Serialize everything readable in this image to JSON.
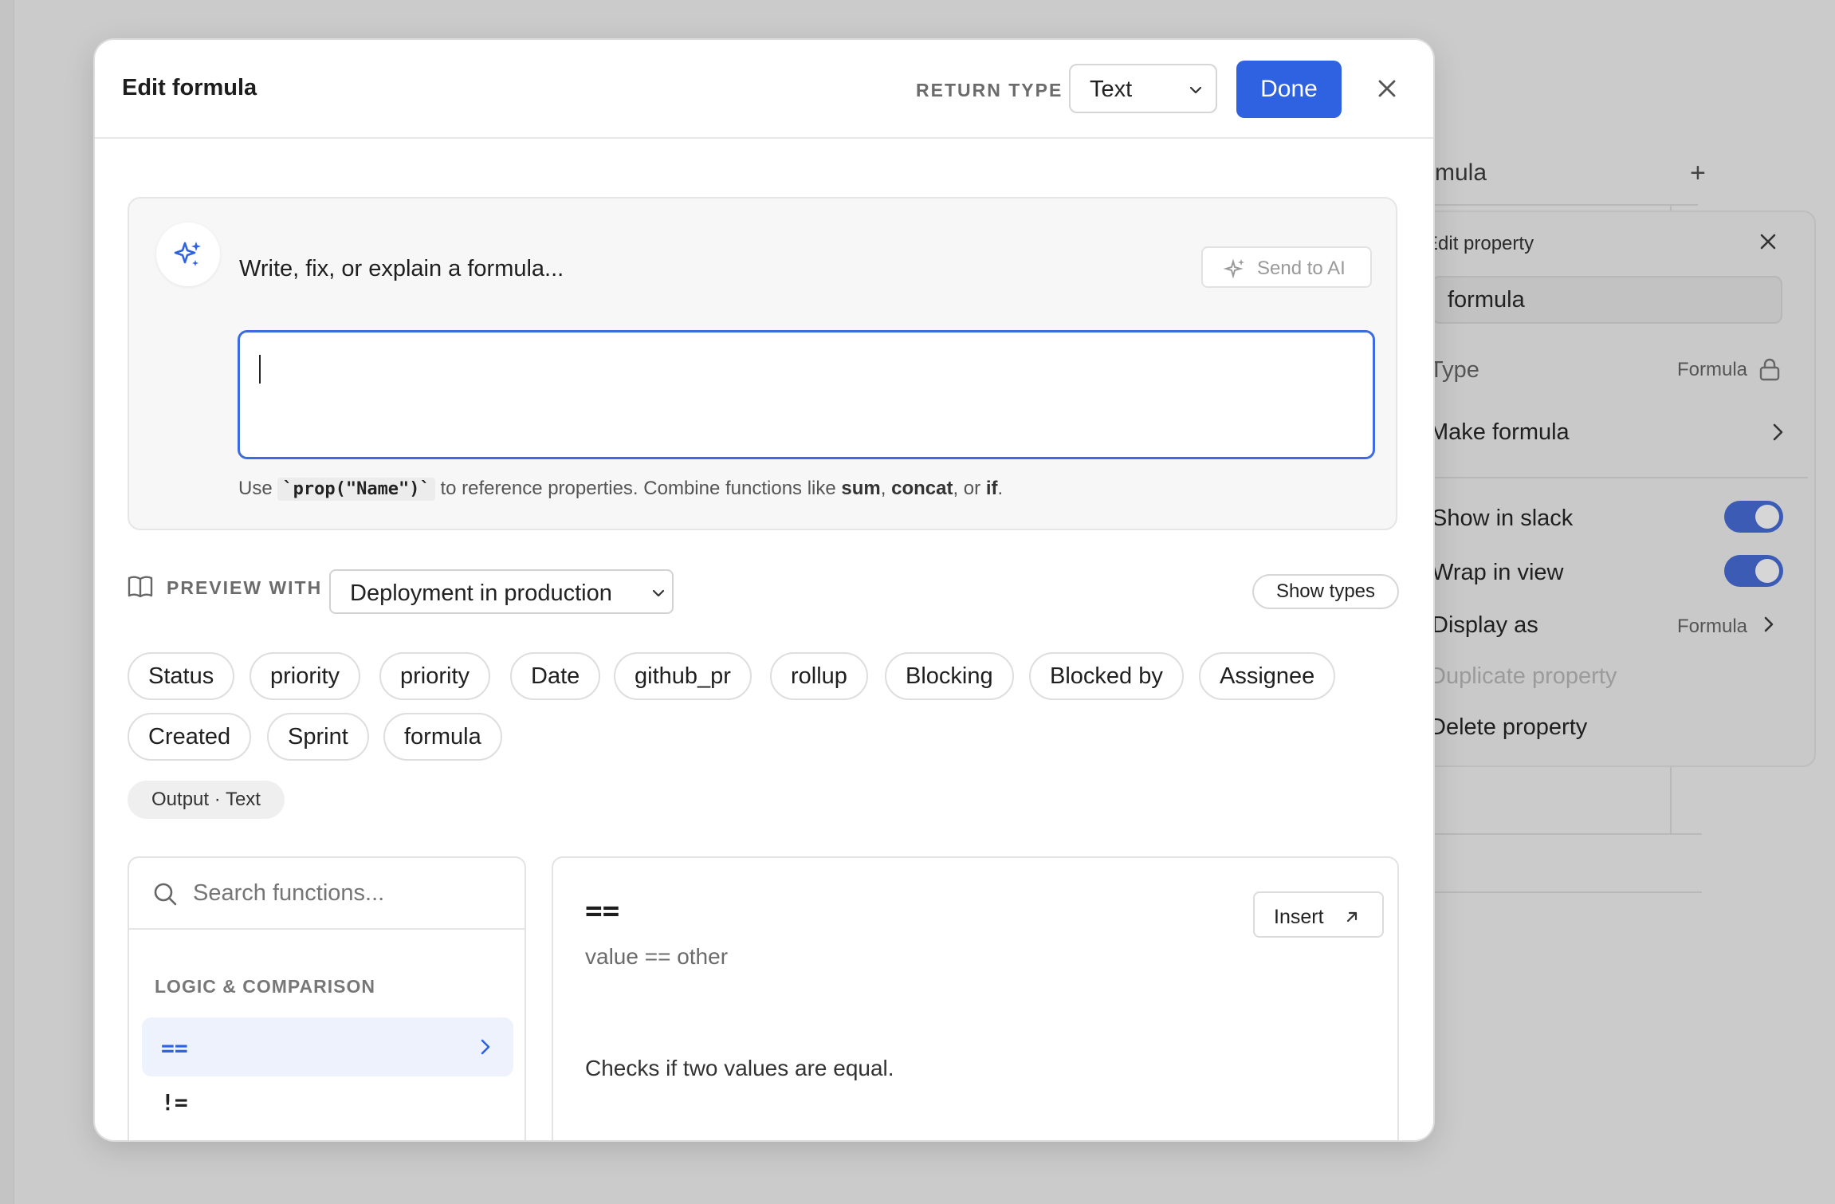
{
  "background": {
    "column_header": "rmula",
    "plus_icon": "plus-icon",
    "edit_property": {
      "title": "Edit property",
      "name_value": "formula",
      "type_label": "Type",
      "type_value": "Formula",
      "make_formula": "Make formula",
      "show_in_slack": "Show in slack",
      "wrap_in_view": "Wrap in view",
      "display_as_label": "Display as",
      "display_as_value": "Formula",
      "duplicate": "Duplicate property",
      "delete": "Delete property",
      "show_in_slack_on": true,
      "wrap_in_view_on": true
    }
  },
  "modal": {
    "title": "Edit formula",
    "return_type_label": "RETURN TYPE",
    "return_type_value": "Text",
    "done_label": "Done",
    "ai": {
      "prompt": "Write, fix, or explain a formula...",
      "send_label": "Send to AI",
      "input_value": "",
      "hint_use": "Use",
      "hint_code": "`prop(\"Name\")`",
      "hint_middle": "to reference properties. Combine functions like",
      "hint_fn1": "sum",
      "hint_fn2": "concat",
      "hint_or": ", or",
      "hint_fn3": "if",
      "hint_end": "."
    },
    "preview": {
      "label": "PREVIEW WITH",
      "selected": "Deployment in production",
      "show_types": "Show types"
    },
    "properties": [
      "Status",
      "priority",
      "priority",
      "Date",
      "github_pr",
      "rollup",
      "Blocking",
      "Blocked by",
      "Assignee",
      "Created",
      "Sprint",
      "formula"
    ],
    "output_chip": "Output · Text",
    "functions": {
      "search_placeholder": "Search functions...",
      "section": "LOGIC & COMPARISON",
      "items": [
        "==",
        "!="
      ]
    },
    "detail": {
      "name": "==",
      "signature": "value == other",
      "description": "Checks if two values are equal.",
      "insert_label": "Insert"
    }
  },
  "colors": {
    "accent": "#2f62e0",
    "toggle_bg": "#3b5bb5"
  }
}
